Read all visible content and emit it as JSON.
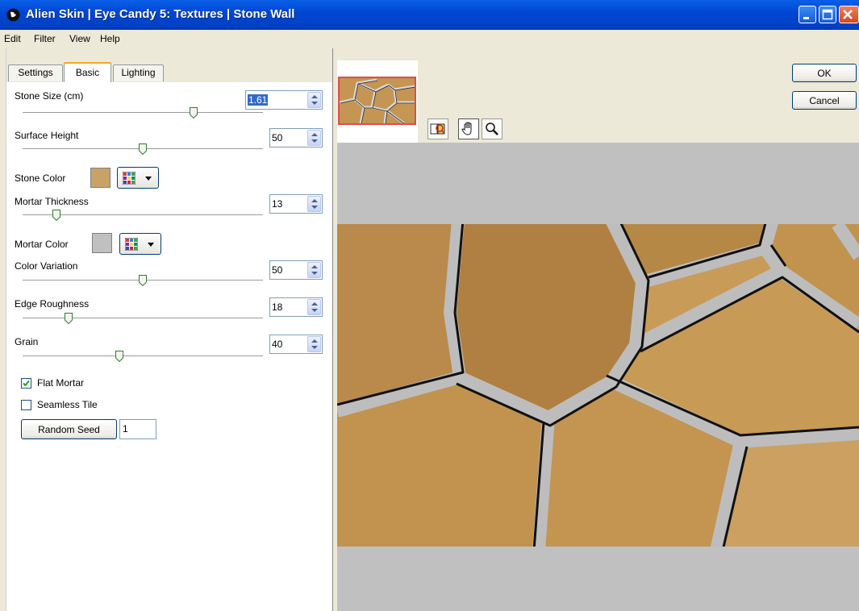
{
  "window": {
    "title": "Alien Skin | Eye Candy 5: Textures | Stone Wall"
  },
  "menu": [
    "Edit",
    "Filter",
    "View",
    "Help"
  ],
  "tabs": [
    {
      "label": "Settings",
      "active": false
    },
    {
      "label": "Basic",
      "active": true
    },
    {
      "label": "Lighting",
      "active": false
    }
  ],
  "controls": {
    "stone_size": {
      "label": "Stone Size (cm)",
      "value": "1.61",
      "slider": 0.72
    },
    "surface_height": {
      "label": "Surface Height",
      "value": "50",
      "slider": 0.5
    },
    "stone_color": {
      "label": "Stone Color",
      "color": "#c9a266"
    },
    "mortar_thickness": {
      "label": "Mortar Thickness",
      "value": "13",
      "slider": 0.13
    },
    "mortar_color": {
      "label": "Mortar Color",
      "color": "#c0c0c0"
    },
    "color_variation": {
      "label": "Color Variation",
      "value": "50",
      "slider": 0.5
    },
    "edge_roughness": {
      "label": "Edge Roughness",
      "value": "18",
      "slider": 0.18
    },
    "grain": {
      "label": "Grain",
      "value": "40",
      "slider": 0.4
    },
    "flat_mortar": {
      "label": "Flat Mortar",
      "checked": true
    },
    "seamless_tile": {
      "label": "Seamless Tile",
      "checked": false
    },
    "random_seed": {
      "label": "Random Seed",
      "value": "1"
    }
  },
  "buttons": {
    "ok": "OK",
    "cancel": "Cancel"
  },
  "icons": {
    "app_logo": "alien-skin-logo-icon",
    "compare": "before-after-compare-icon",
    "pan": "hand-pan-icon",
    "zoom": "magnifier-zoom-icon"
  },
  "colors": {
    "titlebar": "#0047d6",
    "accent_tab": "#f5a623",
    "selection": "#316ac5",
    "preview_background": "#c0c0c0"
  }
}
